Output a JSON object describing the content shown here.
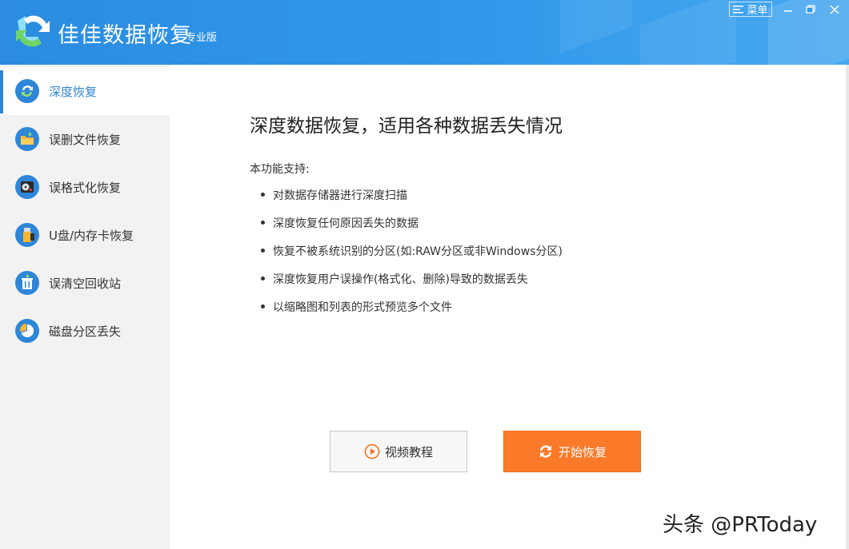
{
  "app": {
    "title": "佳佳数据恢复",
    "edition": "专业版",
    "menu_label": "菜单"
  },
  "sidebar": {
    "items": [
      {
        "label": "深度恢复",
        "icon": "refresh-icon",
        "active": true
      },
      {
        "label": "误删文件恢复",
        "icon": "folder-restore-icon",
        "active": false
      },
      {
        "label": "误格式化恢复",
        "icon": "disk-format-icon",
        "active": false
      },
      {
        "label": "U盘/内存卡恢复",
        "icon": "usb-drive-icon",
        "active": false
      },
      {
        "label": "误清空回收站",
        "icon": "recycle-bin-icon",
        "active": false
      },
      {
        "label": "磁盘分区丢失",
        "icon": "partition-pie-icon",
        "active": false
      }
    ]
  },
  "main": {
    "title": "深度数据恢复，适用各种数据丢失情况",
    "support_label": "本功能支持:",
    "features": [
      "对数据存储器进行深度扫描",
      "深度恢复任何原因丢失的数据",
      "恢复不被系统识别的分区(如:RAW分区或非Windows分区)",
      "深度恢复用户误操作(格式化、删除)导致的数据丢失",
      "以缩略图和列表的形式预览多个文件"
    ],
    "video_button": "视频教程",
    "start_button": "开始恢复"
  },
  "watermark": "头条 @PRToday",
  "colors": {
    "titlebar": "#2f98ea",
    "accent": "#2e86d8",
    "start_button": "#fb7a29",
    "sidebar_bg": "#f2f2f2"
  }
}
